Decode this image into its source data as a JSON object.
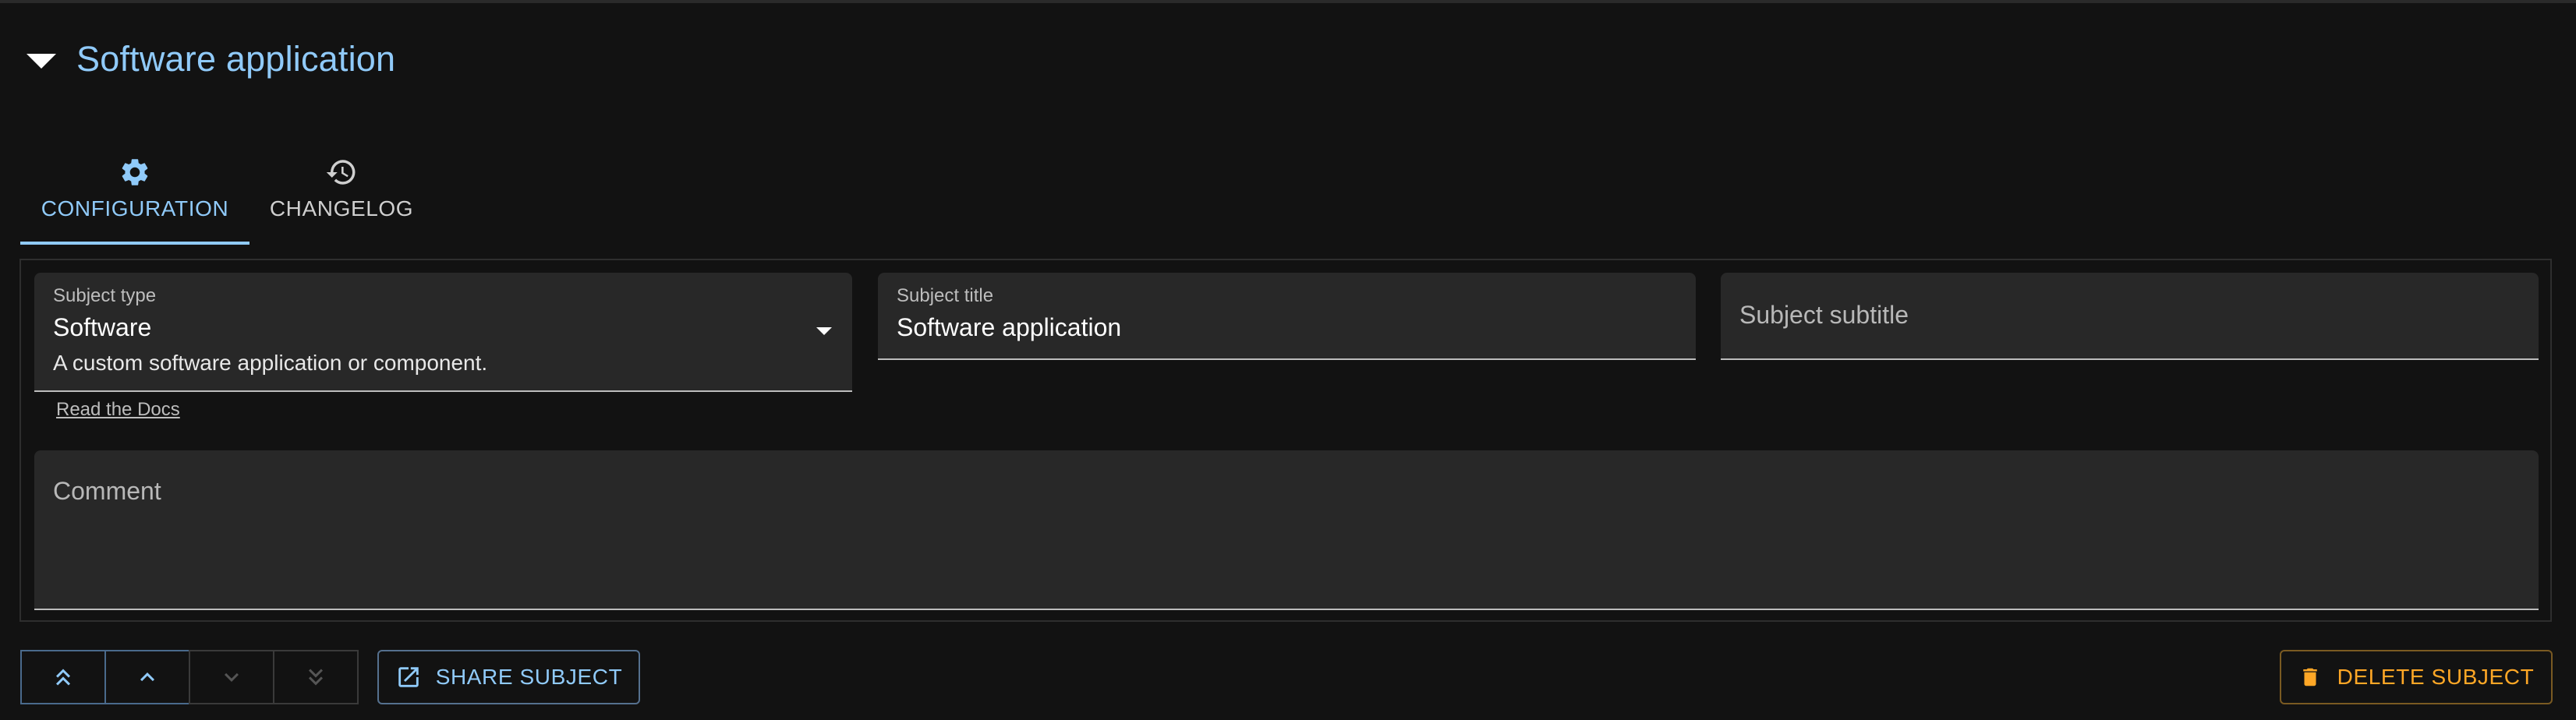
{
  "header": {
    "title": "Software application"
  },
  "tabs": [
    {
      "label": "CONFIGURATION",
      "icon": "gear-icon",
      "active": true
    },
    {
      "label": "CHANGELOG",
      "icon": "history-icon",
      "active": false
    }
  ],
  "form": {
    "subject_type": {
      "label": "Subject type",
      "value": "Software",
      "description": "A custom software application or component."
    },
    "subject_title": {
      "label": "Subject title",
      "value": "Software application"
    },
    "subject_subtitle": {
      "placeholder": "Subject subtitle"
    },
    "docs_link": "Read the Docs",
    "comment": {
      "placeholder": "Comment"
    }
  },
  "actions": {
    "share_label": "SHARE SUBJECT",
    "delete_label": "DELETE SUBJECT"
  },
  "colors": {
    "accent": "#90caf9",
    "warning": "#ffa726",
    "background": "#121212",
    "field": "#282828"
  }
}
